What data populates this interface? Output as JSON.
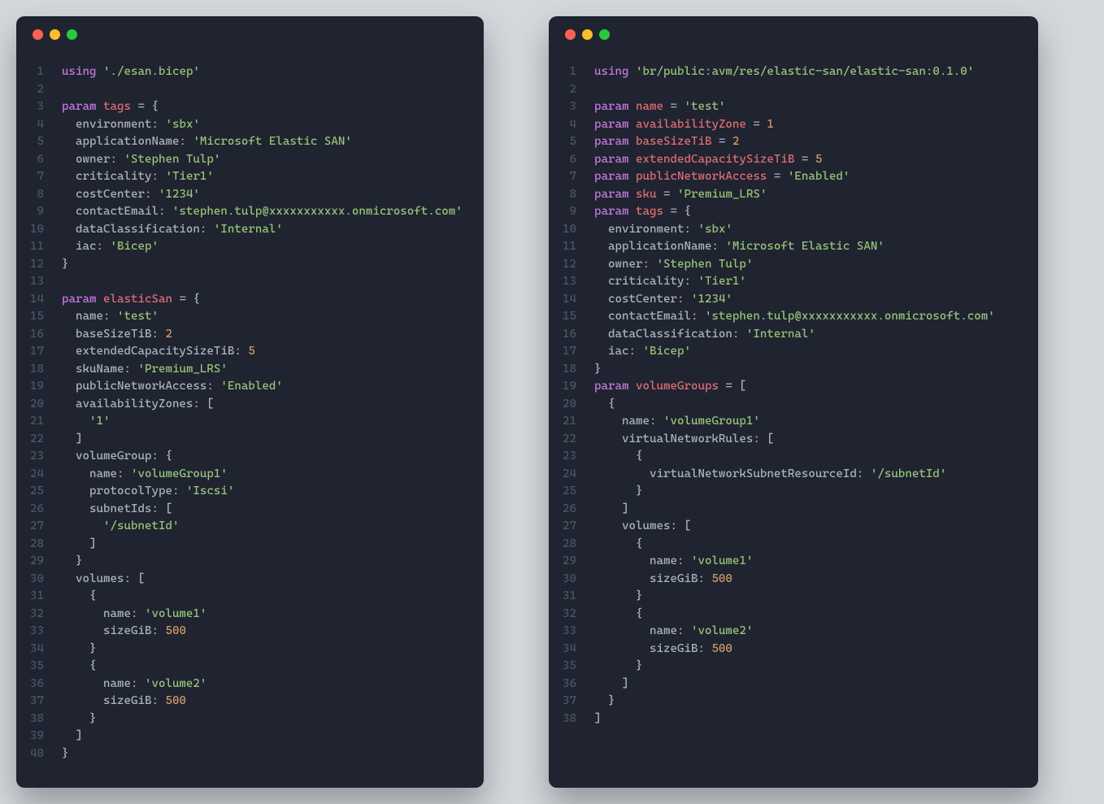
{
  "windows": [
    {
      "id": "w1",
      "lines": [
        [
          [
            "k-kw",
            "using"
          ],
          [
            "k-punc",
            " "
          ],
          [
            "k-str",
            "'./esan.bicep'"
          ]
        ],
        [],
        [
          [
            "k-kw",
            "param"
          ],
          [
            "k-punc",
            " "
          ],
          [
            "k-ident",
            "tags"
          ],
          [
            "k-punc",
            " = {"
          ]
        ],
        [
          [
            "k-prop",
            "  environment: "
          ],
          [
            "k-str",
            "'sbx'"
          ]
        ],
        [
          [
            "k-prop",
            "  applicationName: "
          ],
          [
            "k-str",
            "'Microsoft Elastic SAN'"
          ]
        ],
        [
          [
            "k-prop",
            "  owner: "
          ],
          [
            "k-str",
            "'Stephen Tulp'"
          ]
        ],
        [
          [
            "k-prop",
            "  criticality: "
          ],
          [
            "k-str",
            "'Tier1'"
          ]
        ],
        [
          [
            "k-prop",
            "  costCenter: "
          ],
          [
            "k-str",
            "'1234'"
          ]
        ],
        [
          [
            "k-prop",
            "  contactEmail: "
          ],
          [
            "k-str",
            "'stephen.tulp@xxxxxxxxxxx.onmicrosoft.com'"
          ]
        ],
        [
          [
            "k-prop",
            "  dataClassification: "
          ],
          [
            "k-str",
            "'Internal'"
          ]
        ],
        [
          [
            "k-prop",
            "  iac: "
          ],
          [
            "k-str",
            "'Bicep'"
          ]
        ],
        [
          [
            "k-punc",
            "}"
          ]
        ],
        [],
        [
          [
            "k-kw",
            "param"
          ],
          [
            "k-punc",
            " "
          ],
          [
            "k-ident",
            "elasticSan"
          ],
          [
            "k-punc",
            " = {"
          ]
        ],
        [
          [
            "k-prop",
            "  name: "
          ],
          [
            "k-str",
            "'test'"
          ]
        ],
        [
          [
            "k-prop",
            "  baseSizeTiB: "
          ],
          [
            "k-num",
            "2"
          ]
        ],
        [
          [
            "k-prop",
            "  extendedCapacitySizeTiB: "
          ],
          [
            "k-num",
            "5"
          ]
        ],
        [
          [
            "k-prop",
            "  skuName: "
          ],
          [
            "k-str",
            "'Premium_LRS'"
          ]
        ],
        [
          [
            "k-prop",
            "  publicNetworkAccess: "
          ],
          [
            "k-str",
            "'Enabled'"
          ]
        ],
        [
          [
            "k-prop",
            "  availabilityZones: ["
          ]
        ],
        [
          [
            "k-punc",
            "    "
          ],
          [
            "k-str",
            "'1'"
          ]
        ],
        [
          [
            "k-prop",
            "  ]"
          ]
        ],
        [
          [
            "k-prop",
            "  volumeGroup: {"
          ]
        ],
        [
          [
            "k-prop",
            "    name: "
          ],
          [
            "k-str",
            "'volumeGroup1'"
          ]
        ],
        [
          [
            "k-prop",
            "    protocolType: "
          ],
          [
            "k-str",
            "'Iscsi'"
          ]
        ],
        [
          [
            "k-prop",
            "    subnetIds: ["
          ]
        ],
        [
          [
            "k-punc",
            "      "
          ],
          [
            "k-str",
            "'/subnetId'"
          ]
        ],
        [
          [
            "k-prop",
            "    ]"
          ]
        ],
        [
          [
            "k-prop",
            "  }"
          ]
        ],
        [
          [
            "k-prop",
            "  volumes: ["
          ]
        ],
        [
          [
            "k-prop",
            "    {"
          ]
        ],
        [
          [
            "k-prop",
            "      name: "
          ],
          [
            "k-str",
            "'volume1'"
          ]
        ],
        [
          [
            "k-prop",
            "      sizeGiB: "
          ],
          [
            "k-num",
            "500"
          ]
        ],
        [
          [
            "k-prop",
            "    }"
          ]
        ],
        [
          [
            "k-prop",
            "    {"
          ]
        ],
        [
          [
            "k-prop",
            "      name: "
          ],
          [
            "k-str",
            "'volume2'"
          ]
        ],
        [
          [
            "k-prop",
            "      sizeGiB: "
          ],
          [
            "k-num",
            "500"
          ]
        ],
        [
          [
            "k-prop",
            "    }"
          ]
        ],
        [
          [
            "k-prop",
            "  ]"
          ]
        ],
        [
          [
            "k-punc",
            "}"
          ]
        ]
      ]
    },
    {
      "id": "w2",
      "lines": [
        [
          [
            "k-kw",
            "using"
          ],
          [
            "k-punc",
            " "
          ],
          [
            "k-str",
            "'br/public:avm/res/elastic-san/elastic-san:0.1.0'"
          ]
        ],
        [],
        [
          [
            "k-kw",
            "param"
          ],
          [
            "k-punc",
            " "
          ],
          [
            "k-ident",
            "name"
          ],
          [
            "k-punc",
            " = "
          ],
          [
            "k-str",
            "'test'"
          ]
        ],
        [
          [
            "k-kw",
            "param"
          ],
          [
            "k-punc",
            " "
          ],
          [
            "k-ident",
            "availabilityZone"
          ],
          [
            "k-punc",
            " = "
          ],
          [
            "k-num",
            "1"
          ]
        ],
        [
          [
            "k-kw",
            "param"
          ],
          [
            "k-punc",
            " "
          ],
          [
            "k-ident",
            "baseSizeTiB"
          ],
          [
            "k-punc",
            " = "
          ],
          [
            "k-num",
            "2"
          ]
        ],
        [
          [
            "k-kw",
            "param"
          ],
          [
            "k-punc",
            " "
          ],
          [
            "k-ident",
            "extendedCapacitySizeTiB"
          ],
          [
            "k-punc",
            " = "
          ],
          [
            "k-num",
            "5"
          ]
        ],
        [
          [
            "k-kw",
            "param"
          ],
          [
            "k-punc",
            " "
          ],
          [
            "k-ident",
            "publicNetworkAccess"
          ],
          [
            "k-punc",
            " = "
          ],
          [
            "k-str",
            "'Enabled'"
          ]
        ],
        [
          [
            "k-kw",
            "param"
          ],
          [
            "k-punc",
            " "
          ],
          [
            "k-ident",
            "sku"
          ],
          [
            "k-punc",
            " = "
          ],
          [
            "k-str",
            "'Premium_LRS'"
          ]
        ],
        [
          [
            "k-kw",
            "param"
          ],
          [
            "k-punc",
            " "
          ],
          [
            "k-ident",
            "tags"
          ],
          [
            "k-punc",
            " = {"
          ]
        ],
        [
          [
            "k-prop",
            "  environment: "
          ],
          [
            "k-str",
            "'sbx'"
          ]
        ],
        [
          [
            "k-prop",
            "  applicationName: "
          ],
          [
            "k-str",
            "'Microsoft Elastic SAN'"
          ]
        ],
        [
          [
            "k-prop",
            "  owner: "
          ],
          [
            "k-str",
            "'Stephen Tulp'"
          ]
        ],
        [
          [
            "k-prop",
            "  criticality: "
          ],
          [
            "k-str",
            "'Tier1'"
          ]
        ],
        [
          [
            "k-prop",
            "  costCenter: "
          ],
          [
            "k-str",
            "'1234'"
          ]
        ],
        [
          [
            "k-prop",
            "  contactEmail: "
          ],
          [
            "k-str",
            "'stephen.tulp@xxxxxxxxxxx.onmicrosoft.com'"
          ]
        ],
        [
          [
            "k-prop",
            "  dataClassification: "
          ],
          [
            "k-str",
            "'Internal'"
          ]
        ],
        [
          [
            "k-prop",
            "  iac: "
          ],
          [
            "k-str",
            "'Bicep'"
          ]
        ],
        [
          [
            "k-punc",
            "}"
          ]
        ],
        [
          [
            "k-kw",
            "param"
          ],
          [
            "k-punc",
            " "
          ],
          [
            "k-ident",
            "volumeGroups"
          ],
          [
            "k-punc",
            " = ["
          ]
        ],
        [
          [
            "k-prop",
            "  {"
          ]
        ],
        [
          [
            "k-prop",
            "    name: "
          ],
          [
            "k-str",
            "'volumeGroup1'"
          ]
        ],
        [
          [
            "k-prop",
            "    virtualNetworkRules: ["
          ]
        ],
        [
          [
            "k-prop",
            "      {"
          ]
        ],
        [
          [
            "k-prop",
            "        virtualNetworkSubnetResourceId: "
          ],
          [
            "k-str",
            "'/subnetId'"
          ]
        ],
        [
          [
            "k-prop",
            "      }"
          ]
        ],
        [
          [
            "k-prop",
            "    ]"
          ]
        ],
        [
          [
            "k-prop",
            "    volumes: ["
          ]
        ],
        [
          [
            "k-prop",
            "      {"
          ]
        ],
        [
          [
            "k-prop",
            "        name: "
          ],
          [
            "k-str",
            "'volume1'"
          ]
        ],
        [
          [
            "k-prop",
            "        sizeGiB: "
          ],
          [
            "k-num",
            "500"
          ]
        ],
        [
          [
            "k-prop",
            "      }"
          ]
        ],
        [
          [
            "k-prop",
            "      {"
          ]
        ],
        [
          [
            "k-prop",
            "        name: "
          ],
          [
            "k-str",
            "'volume2'"
          ]
        ],
        [
          [
            "k-prop",
            "        sizeGiB: "
          ],
          [
            "k-num",
            "500"
          ]
        ],
        [
          [
            "k-prop",
            "      }"
          ]
        ],
        [
          [
            "k-prop",
            "    ]"
          ]
        ],
        [
          [
            "k-prop",
            "  }"
          ]
        ],
        [
          [
            "k-punc",
            "]"
          ]
        ]
      ]
    }
  ]
}
